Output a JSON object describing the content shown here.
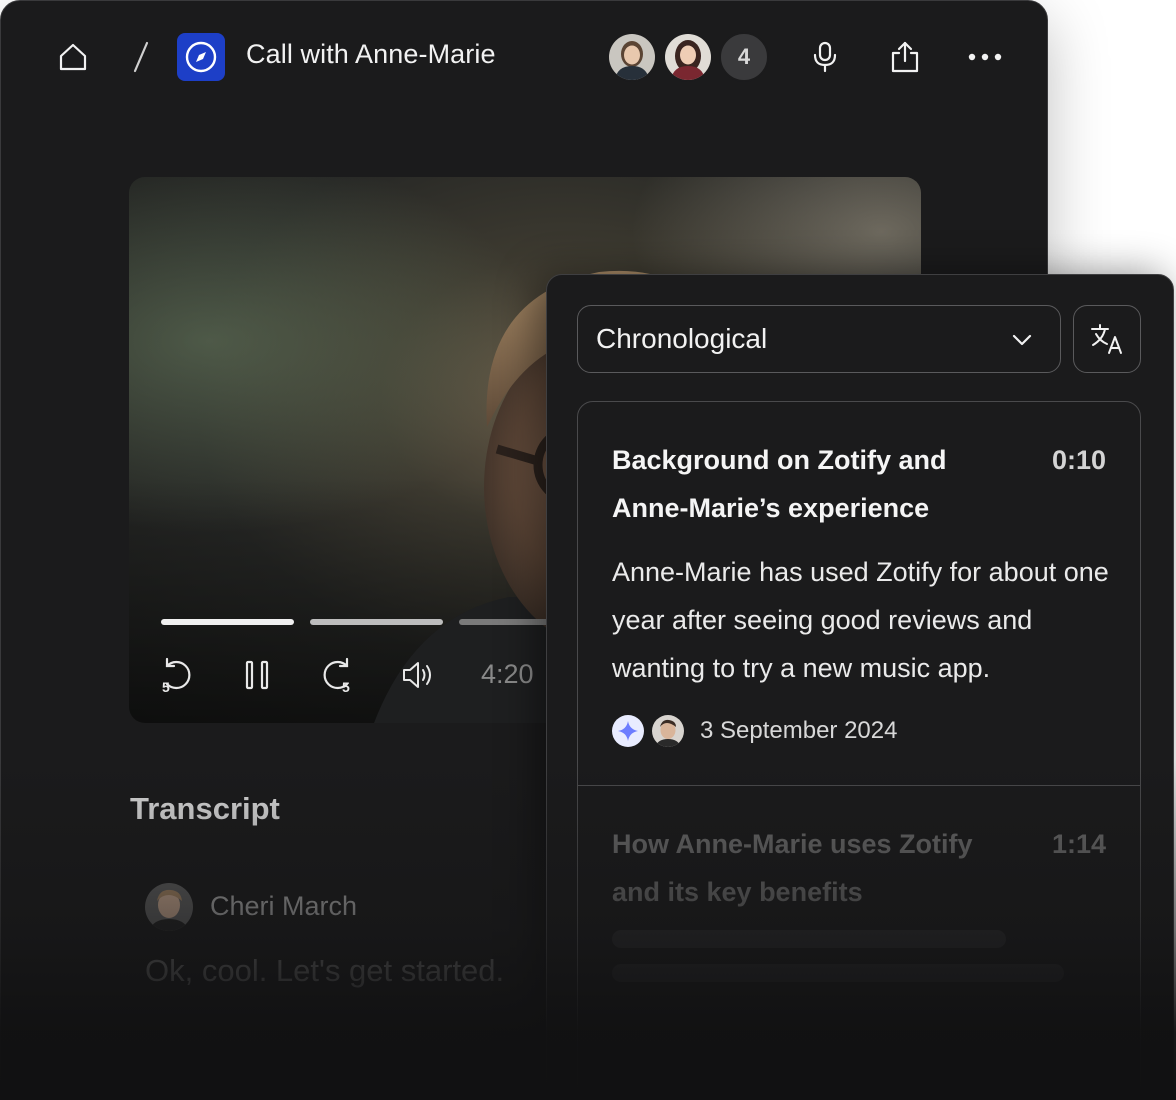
{
  "header": {
    "title": "Call with Anne-Marie",
    "participant_overflow_count": "4",
    "icons": [
      "home-icon",
      "compass-icon",
      "microphone-icon",
      "share-icon",
      "more-icon"
    ]
  },
  "video": {
    "elapsed_time": "4:20",
    "progress_segments": [
      1.0,
      1.0,
      0.4
    ],
    "controls": [
      "rewind-5-icon",
      "pause-icon",
      "forward-5-icon",
      "volume-icon"
    ],
    "rewind_seconds": "5",
    "forward_seconds": "5"
  },
  "transcript": {
    "heading": "Transcript",
    "entries": [
      {
        "speaker": "Cheri March",
        "text": "Ok, cool. Let's get started."
      }
    ]
  },
  "panel": {
    "sort_value": "Chronological",
    "chapters": [
      {
        "title": "Background on Zotify and Anne-Marie’s experience",
        "time": "0:10",
        "summary": "Anne-Marie has used Zotify for about one year after seeing good reviews and wanting to try a new music app.",
        "date": "3 September 2024"
      },
      {
        "title": "How Anne-Marie uses Zotify and its key benefits",
        "time": "1:14"
      }
    ]
  },
  "colors": {
    "background": "#1b1b1c",
    "app_icon": "#1d3fc7",
    "ai_badge": "#6d7dff"
  }
}
